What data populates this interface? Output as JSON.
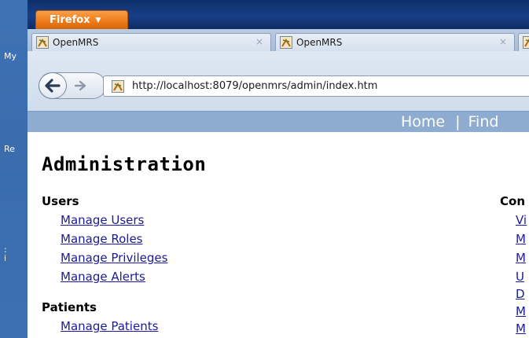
{
  "desktop": {
    "labels": [
      "My",
      "Re",
      ":",
      "i"
    ]
  },
  "browser": {
    "menu_label": "Firefox",
    "menu_arrow": "▼",
    "tabs": [
      {
        "label": "OpenMRS",
        "close": "×"
      },
      {
        "label": "OpenMRS",
        "close": "×"
      }
    ],
    "url": "http://localhost:8079/openmrs/admin/index.htm"
  },
  "page": {
    "topnav": {
      "home": "Home",
      "separator": "|",
      "find": "Find"
    },
    "title": "Administration",
    "sections": {
      "users": {
        "heading": "Users",
        "links": [
          "Manage Users",
          "Manage Roles",
          "Manage Privileges",
          "Manage Alerts"
        ]
      },
      "patients": {
        "heading": "Patients",
        "links": [
          "Manage Patients"
        ]
      },
      "right": {
        "heading": "Con",
        "links": [
          "Vi",
          "M",
          "M",
          "U",
          "D",
          "M",
          "M"
        ]
      }
    }
  },
  "colors": {
    "link": "#1a1a9e",
    "header_bar": "#8eaccf",
    "firefox_button": "#ee7d1a",
    "titlebar": "#183f86"
  }
}
